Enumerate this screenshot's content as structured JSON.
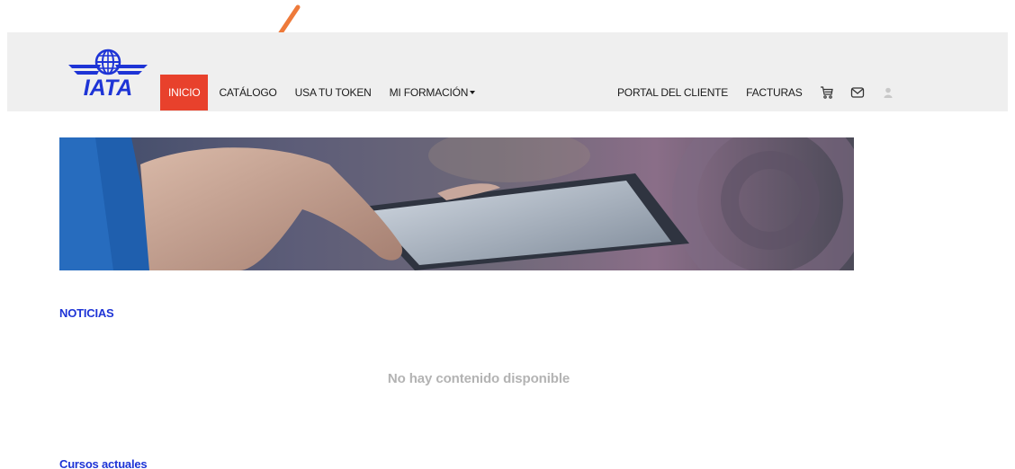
{
  "logo": {
    "text": "IATA",
    "color": "#1e34d6"
  },
  "nav": {
    "left": [
      {
        "label": "INICIO",
        "active": true
      },
      {
        "label": "CATÁLOGO",
        "active": false
      },
      {
        "label": "USA TU TOKEN",
        "active": false
      },
      {
        "label": "MI FORMACIÓN",
        "active": false,
        "dropdown": true
      }
    ],
    "right": [
      {
        "label": "PORTAL DEL CLIENTE"
      },
      {
        "label": "FACTURAS"
      }
    ],
    "icons": [
      "cart-icon",
      "mail-icon",
      "user-avatar-icon"
    ],
    "active_color": "#e8412c"
  },
  "annotation": {
    "arrow_color": "#ee7a3a",
    "target": "CATÁLOGO"
  },
  "main": {
    "news_title": "NOTICIAS",
    "empty_message": "No hay contenido disponible",
    "courses_title": "Cursos actuales"
  }
}
